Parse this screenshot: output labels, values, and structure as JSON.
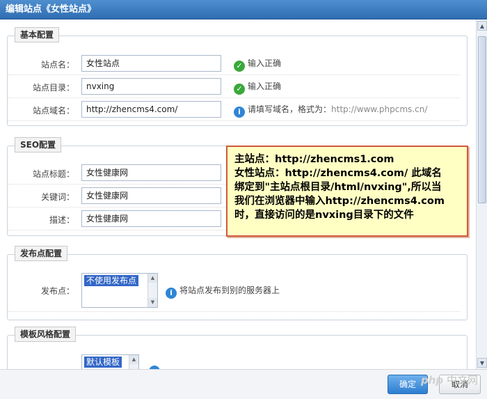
{
  "window": {
    "title": "编辑站点《女性站点》"
  },
  "basic": {
    "legend": "基本配置",
    "name_label": "站点名：",
    "name_value": "女性站点",
    "name_hint": "输入正确",
    "dir_label": "站点目录：",
    "dir_value": "nvxing",
    "dir_hint": "输入正确",
    "domain_label": "站点域名：",
    "domain_value": "http://zhencms4.com/",
    "domain_hint": "请填写域名，格式为：",
    "domain_hint_example": "http://www.phpcms.cn/"
  },
  "seo": {
    "legend": "SEO配置",
    "title_label": "站点标题：",
    "title_value": "女性健康网",
    "keywords_label": "关键词：",
    "keywords_value": "女性健康网",
    "desc_label": "描述：",
    "desc_value": "女性健康网"
  },
  "publish": {
    "legend": "发布点配置",
    "label": "发布点：",
    "selected_option": "不使用发布点",
    "hint": "将站点发布到别的服务器上"
  },
  "template": {
    "legend": "模板风格配置",
    "selected_option": "默认模板"
  },
  "note": {
    "lines": [
      "主站点：http://zhencms1.com",
      "女性站点：http://zhencms4.com/   此域名",
      "绑定到\"主站点根目录/html/nvxing\",所以当",
      "我们在浏览器中输入http://zhencms4.com",
      "时，直接访问的是nvxing目录下的文件"
    ]
  },
  "buttons": {
    "ok": "确定",
    "cancel": "取消"
  },
  "watermark": {
    "brand": "php",
    "text": "中文网"
  },
  "colors": {
    "title_bar": "#3a7bc0",
    "note_bg": "#ffffc4",
    "note_border": "#d0583c",
    "ok_icon": "#3aa83a",
    "info_icon": "#2f86d6"
  }
}
